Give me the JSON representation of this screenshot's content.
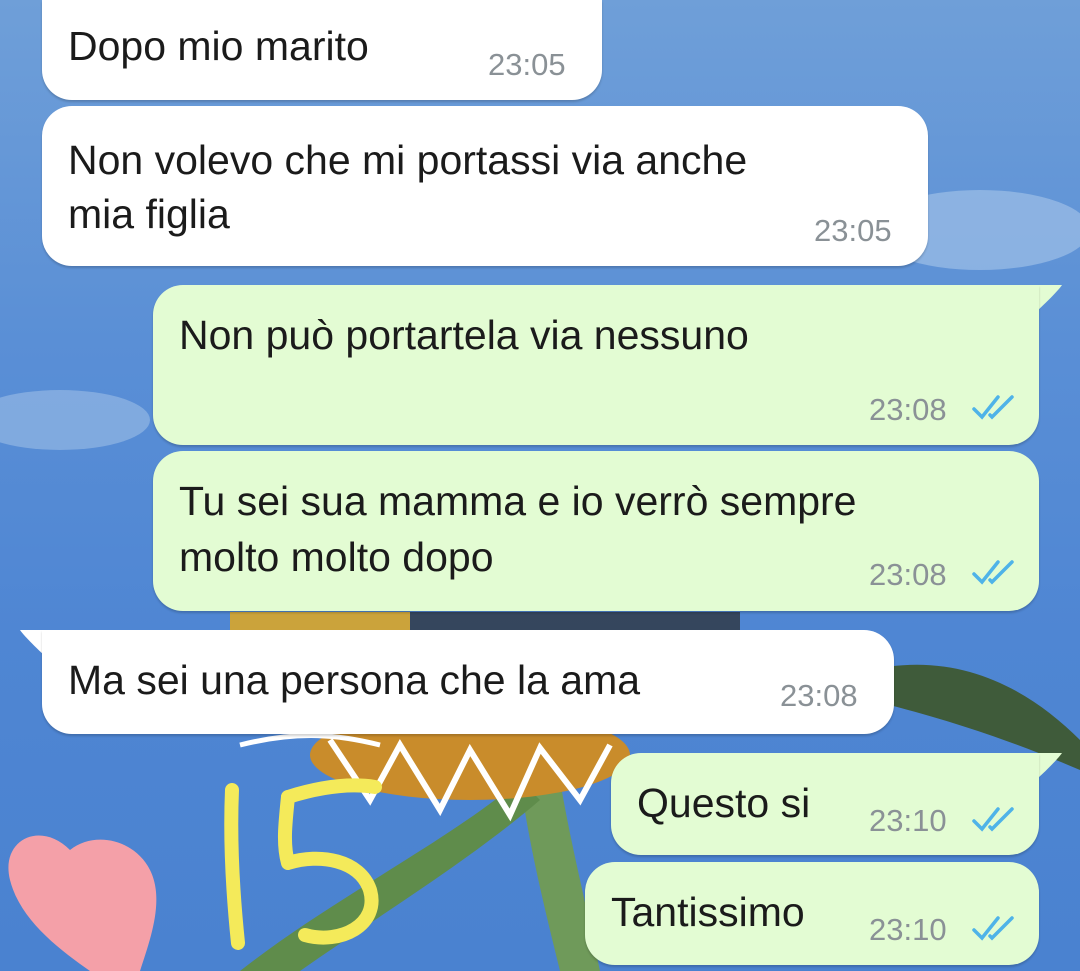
{
  "messages": [
    {
      "id": "m1",
      "direction": "incoming",
      "text_lines": [
        "Dopo mio marito"
      ],
      "time": "23:05"
    },
    {
      "id": "m2",
      "direction": "incoming",
      "text_lines": [
        "Non volevo che mi portassi via anche",
        "mia figlia"
      ],
      "time": "23:05"
    },
    {
      "id": "m3",
      "direction": "outgoing",
      "text_lines": [
        "Non può portartela via nessuno"
      ],
      "time": "23:08",
      "status": "read-double-check-icon"
    },
    {
      "id": "m4",
      "direction": "outgoing",
      "text_lines": [
        "Tu sei sua mamma e io verrò sempre",
        "molto molto dopo"
      ],
      "time": "23:08",
      "status": "read-double-check-icon"
    },
    {
      "id": "m5",
      "direction": "incoming",
      "text_lines": [
        "Ma sei una persona che la ama"
      ],
      "time": "23:08"
    },
    {
      "id": "m6",
      "direction": "outgoing",
      "text_lines": [
        "Questo si"
      ],
      "time": "23:10",
      "status": "read-double-check-icon"
    },
    {
      "id": "m7",
      "direction": "outgoing",
      "text_lines": [
        "Tantissimo"
      ],
      "time": "23:10",
      "status": "read-double-check-icon"
    }
  ],
  "overlay": {
    "handwritten_mark": "15",
    "mark_color": "#f4ea5a"
  },
  "colors": {
    "incoming_bubble": "#ffffff",
    "outgoing_bubble": "#e3fcd3",
    "read_ticks": "#4fb3e8",
    "wallpaper_sky": "#5a8fd6"
  }
}
